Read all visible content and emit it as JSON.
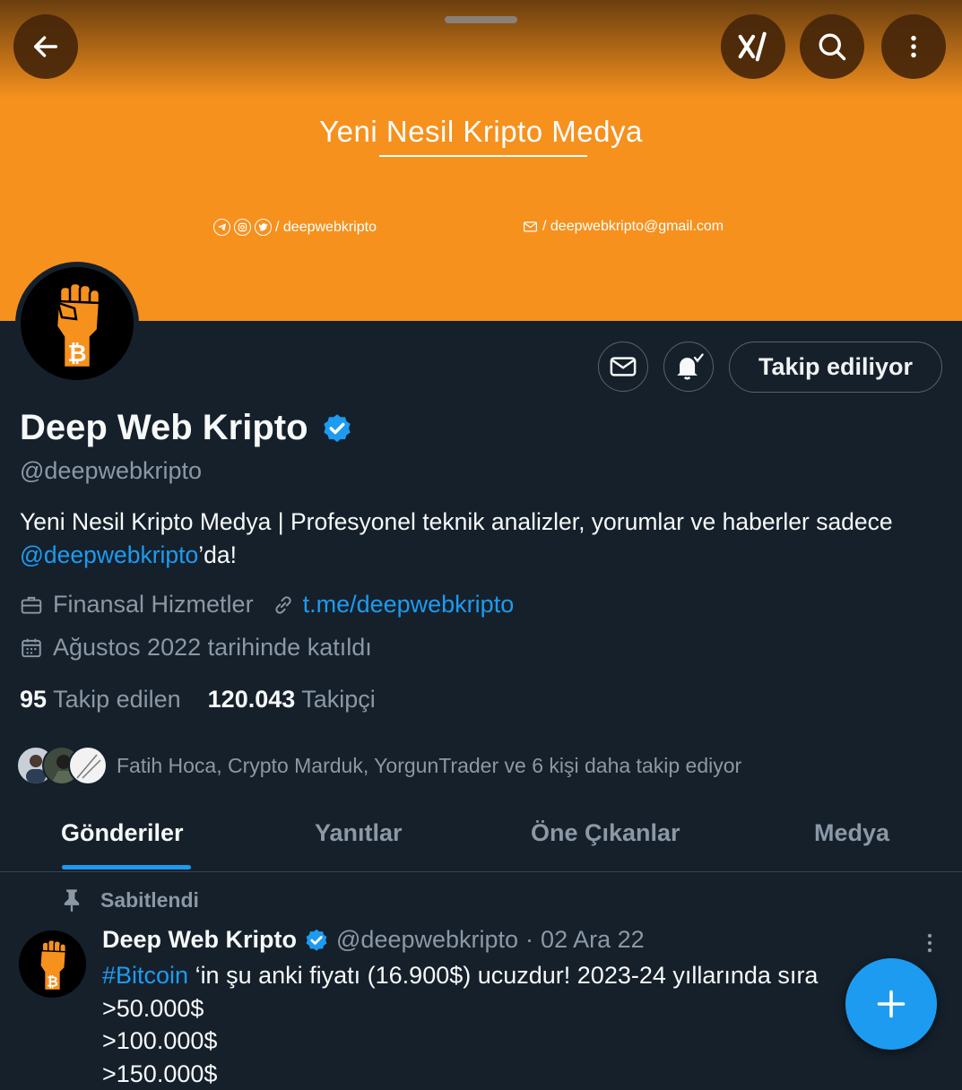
{
  "banner": {
    "title": "Yeni Nesil Kripto Medya",
    "social_text": "/ deepwebkripto",
    "mail_text": "/ deepwebkripto@gmail.com",
    "color": "#f6911e"
  },
  "topbar": {
    "back_icon": "arrow-left-icon",
    "grok_icon": "grok-icon",
    "search_icon": "search-icon",
    "more_icon": "more-vertical-icon"
  },
  "profile": {
    "name": "Deep Web Kripto",
    "verified": true,
    "handle": "@deepwebkripto",
    "bio_text": "Yeni Nesil Kripto Medya | Profesyonel teknik analizler, yorumlar ve haberler sadece ",
    "bio_mention": "@deepwebkripto",
    "bio_suffix": "’da!",
    "category": "Finansal Hizmetler",
    "website": "t.me/deepwebkripto",
    "joined": "Ağustos 2022 tarihinde katıldı",
    "following_count": "95",
    "following_label": "Takip edilen",
    "followers_count": "120.043",
    "followers_label": "Takipçi",
    "followed_by": "Fatih Hoca, Crypto Marduk, YorgunTrader ve 6 kişi daha takip ediyor"
  },
  "actions": {
    "message_icon": "envelope-icon",
    "notify_icon": "bell-check-icon",
    "follow_label": "Takip ediliyor"
  },
  "tabs": [
    {
      "label": "Gönderiler",
      "active": true
    },
    {
      "label": "Yanıtlar",
      "active": false
    },
    {
      "label": "Öne Çıkanlar",
      "active": false
    },
    {
      "label": "Medya",
      "active": false
    }
  ],
  "pinned_tweet": {
    "pinned_label": "Sabitlendi",
    "author": "Deep Web Kripto",
    "handle": "@deepwebkripto",
    "separator": "·",
    "date": "02 Ara 22",
    "hashtag": "#Bitcoin",
    "line1": " ‘in şu anki fiyatı (16.900$) ucuzdur! 2023-24 yıllarında sıra",
    "line2": ">50.000$",
    "line3": ">100.000$",
    "line4": ">150.000$"
  },
  "colors": {
    "accent": "#1d9bf0",
    "background": "#15202b",
    "muted_text": "#8b98a5"
  }
}
